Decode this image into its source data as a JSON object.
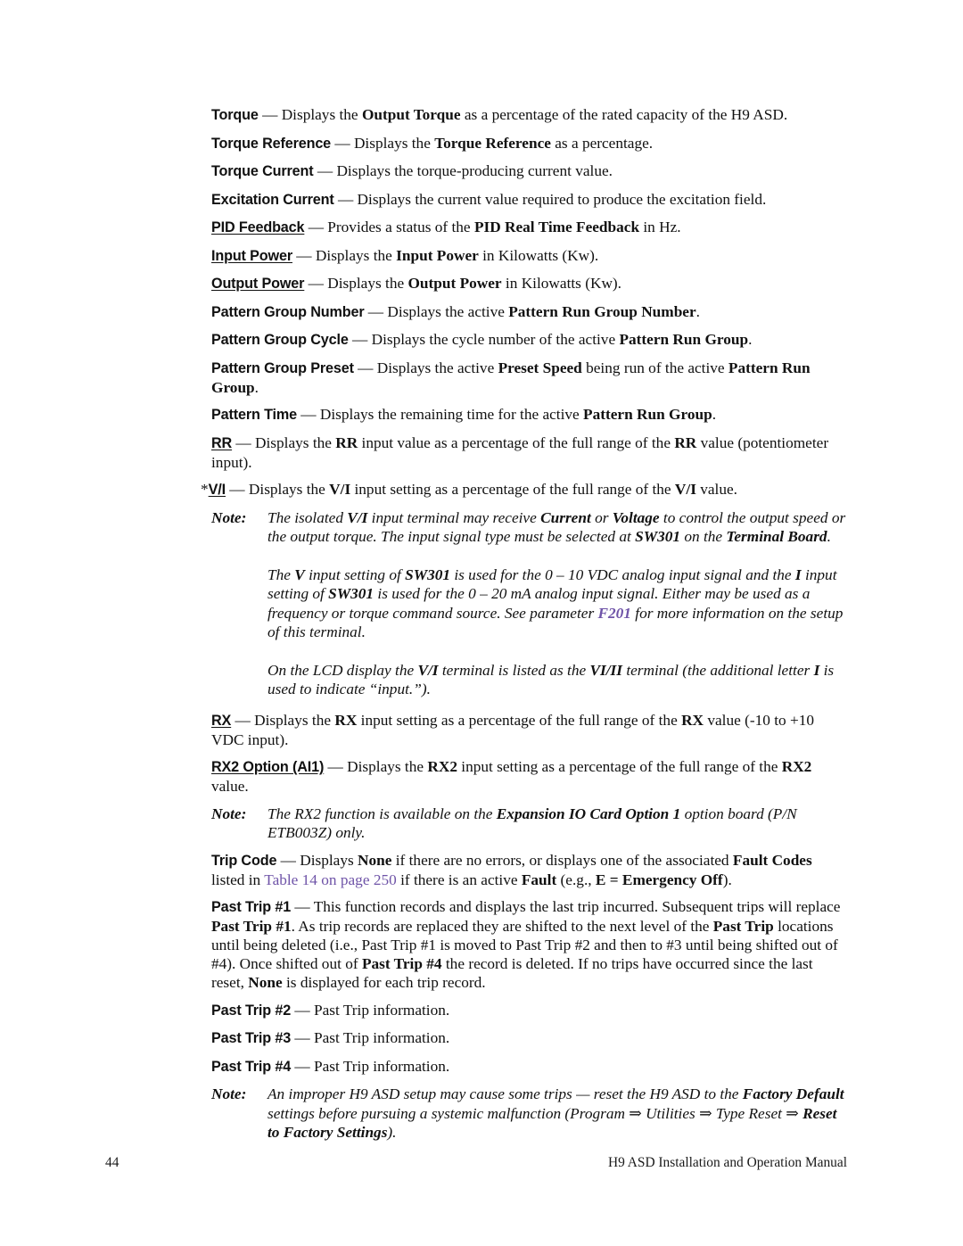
{
  "page": {
    "number": "44",
    "footer_text": "H9 ASD Installation and Operation Manual"
  },
  "colors": {
    "text": "#111111",
    "hyperlink": "#6f54a8",
    "background": "#ffffff"
  },
  "blocks": [
    {
      "id": "torque",
      "type": "entry",
      "runs": [
        {
          "t": "Torque",
          "s": "hw"
        },
        {
          "t": " — Displays the "
        },
        {
          "t": "Output Torque",
          "s": "b"
        },
        {
          "t": " as a percentage of the rated capacity of the H9 ASD."
        }
      ]
    },
    {
      "id": "torque-reference",
      "type": "entry",
      "runs": [
        {
          "t": "Torque Reference",
          "s": "hw"
        },
        {
          "t": " — Displays the "
        },
        {
          "t": "Torque Reference",
          "s": "b"
        },
        {
          "t": " as a percentage."
        }
      ]
    },
    {
      "id": "torque-current",
      "type": "entry",
      "runs": [
        {
          "t": "Torque Current",
          "s": "hw"
        },
        {
          "t": " — Displays the torque-producing current value."
        }
      ]
    },
    {
      "id": "excitation-current",
      "type": "entry",
      "runs": [
        {
          "t": "Excitation Current",
          "s": "hw"
        },
        {
          "t": " — Displays the current value required to produce the excitation field."
        }
      ]
    },
    {
      "id": "pid-feedback",
      "type": "entry",
      "runs": [
        {
          "t": "PID Feedback",
          "s": "hw hw-u"
        },
        {
          "t": " — Provides a status of the "
        },
        {
          "t": "PID Real Time Feedback",
          "s": "b"
        },
        {
          "t": " in Hz."
        }
      ]
    },
    {
      "id": "input-power",
      "type": "entry",
      "runs": [
        {
          "t": "Input Power",
          "s": "hw hw-u"
        },
        {
          "t": " — Displays the "
        },
        {
          "t": "Input Power",
          "s": "b"
        },
        {
          "t": " in Kilowatts (Kw)."
        }
      ]
    },
    {
      "id": "output-power",
      "type": "entry",
      "runs": [
        {
          "t": "Output Power",
          "s": "hw hw-u"
        },
        {
          "t": " — Displays the "
        },
        {
          "t": "Output Power",
          "s": "b"
        },
        {
          "t": " in Kilowatts (Kw)."
        }
      ]
    },
    {
      "id": "pattern-group-number",
      "type": "entry",
      "runs": [
        {
          "t": "Pattern Group Number",
          "s": "hw"
        },
        {
          "t": " — Displays the active "
        },
        {
          "t": "Pattern Run Group Number",
          "s": "b"
        },
        {
          "t": "."
        }
      ]
    },
    {
      "id": "pattern-group-cycle",
      "type": "entry",
      "runs": [
        {
          "t": "Pattern Group Cycle",
          "s": "hw"
        },
        {
          "t": " — Displays the cycle number of the active "
        },
        {
          "t": "Pattern Run Group",
          "s": "b"
        },
        {
          "t": "."
        }
      ]
    },
    {
      "id": "pattern-group-preset",
      "type": "entry",
      "runs": [
        {
          "t": "Pattern Group Preset",
          "s": "hw"
        },
        {
          "t": " — Displays the active "
        },
        {
          "t": "Preset Speed",
          "s": "b"
        },
        {
          "t": " being run of the active "
        },
        {
          "t": "Pattern Run Group",
          "s": "b"
        },
        {
          "t": "."
        }
      ]
    },
    {
      "id": "pattern-time",
      "type": "entry",
      "runs": [
        {
          "t": "Pattern Time",
          "s": "hw"
        },
        {
          "t": " — Displays the remaining time for the active "
        },
        {
          "t": "Pattern Run Group",
          "s": "b"
        },
        {
          "t": "."
        }
      ]
    },
    {
      "id": "rr",
      "type": "entry",
      "runs": [
        {
          "t": "RR",
          "s": "hw hw-u"
        },
        {
          "t": " — Displays the "
        },
        {
          "t": "RR",
          "s": "b"
        },
        {
          "t": " input value as a percentage of the full range of the "
        },
        {
          "t": "RR",
          "s": "b"
        },
        {
          "t": " value (potentiometer input)."
        }
      ]
    },
    {
      "id": "vi",
      "type": "entry-hang",
      "runs": [
        {
          "t": "*",
          "s": "star"
        },
        {
          "t": "V/I",
          "s": "hw hw-u"
        },
        {
          "t": " — Displays the "
        },
        {
          "t": "V/I",
          "s": "b"
        },
        {
          "t": " input setting as a percentage of the full range of the "
        },
        {
          "t": "V/I",
          "s": "b"
        },
        {
          "t": " value."
        }
      ]
    },
    {
      "id": "note-vi",
      "type": "note",
      "label": "Note:",
      "gap": "gap-md",
      "paras": [
        [
          {
            "t": "The isolated ",
            "s": "i"
          },
          {
            "t": "V/I",
            "s": "bi"
          },
          {
            "t": " input terminal may receive ",
            "s": "i"
          },
          {
            "t": "Current",
            "s": "bi"
          },
          {
            "t": " or ",
            "s": "i"
          },
          {
            "t": "Voltage",
            "s": "bi"
          },
          {
            "t": " to control the output speed or the output torque. The input signal type must be selected at ",
            "s": "i"
          },
          {
            "t": "SW301",
            "s": "bi"
          },
          {
            "t": " on the ",
            "s": "i"
          },
          {
            "t": "Terminal Board",
            "s": "bi"
          },
          {
            "t": ".",
            "s": "i"
          }
        ],
        [
          {
            "t": "The ",
            "s": "i"
          },
          {
            "t": "V",
            "s": "bi"
          },
          {
            "t": " input setting of ",
            "s": "i"
          },
          {
            "t": "SW301",
            "s": "bi"
          },
          {
            "t": " is used for the 0 – 10 VDC analog input signal and the ",
            "s": "i"
          },
          {
            "t": "I",
            "s": "bi"
          },
          {
            "t": " input setting of ",
            "s": "i"
          },
          {
            "t": "SW301",
            "s": "bi"
          },
          {
            "t": " is used for the 0 – 20 mA analog input signal. Either may be used as a frequency or torque command source. See parameter ",
            "s": "i"
          },
          {
            "t": "F201",
            "s": "link-b"
          },
          {
            "t": " for more information on the setup of this terminal.",
            "s": "i"
          }
        ],
        [
          {
            "t": "On the LCD display the ",
            "s": "i"
          },
          {
            "t": "V/I",
            "s": "bi"
          },
          {
            "t": " terminal is listed as the ",
            "s": "i"
          },
          {
            "t": "VI/II",
            "s": "bi"
          },
          {
            "t": " terminal (the additional letter ",
            "s": "i"
          },
          {
            "t": "I",
            "s": "bi"
          },
          {
            "t": " is used to indicate “input.”).",
            "s": "i"
          }
        ]
      ]
    },
    {
      "id": "rx",
      "type": "entry",
      "runs": [
        {
          "t": "RX",
          "s": "hw hw-u"
        },
        {
          "t": " — Displays the "
        },
        {
          "t": "RX",
          "s": "b"
        },
        {
          "t": " input setting as a percentage of the full range of the "
        },
        {
          "t": "RX",
          "s": "b"
        },
        {
          "t": " value (-10 to +10 VDC input)."
        }
      ]
    },
    {
      "id": "rx2-option",
      "type": "entry",
      "runs": [
        {
          "t": "RX2 Option (AI1)",
          "s": "hw hw-u"
        },
        {
          "t": " — Displays the "
        },
        {
          "t": "RX2",
          "s": "b"
        },
        {
          "t": " input setting as a percentage of the full range of the "
        },
        {
          "t": "RX2",
          "s": "b"
        },
        {
          "t": " value."
        }
      ]
    },
    {
      "id": "note-rx2",
      "type": "note",
      "label": "Note:",
      "gap": "gap-sm",
      "paras": [
        [
          {
            "t": "The RX2 function is available on the ",
            "s": "i"
          },
          {
            "t": "Expansion IO Card Option 1",
            "s": "bi"
          },
          {
            "t": " option board (P/N ETB003Z) only.",
            "s": "i"
          }
        ]
      ]
    },
    {
      "id": "trip-code",
      "type": "entry",
      "runs": [
        {
          "t": "Trip Code",
          "s": "hw"
        },
        {
          "t": " — Displays "
        },
        {
          "t": "None",
          "s": "b"
        },
        {
          "t": " if there are no errors, or displays one of the associated "
        },
        {
          "t": "Fault Codes",
          "s": "b"
        },
        {
          "t": " listed in "
        },
        {
          "t": "Table 14 on page 250",
          "s": "link"
        },
        {
          "t": " if there is an active "
        },
        {
          "t": "Fault",
          "s": "b"
        },
        {
          "t": " (e.g., "
        },
        {
          "t": "E = Emergency Off",
          "s": "b"
        },
        {
          "t": ")."
        }
      ]
    },
    {
      "id": "past-trip-1",
      "type": "entry",
      "runs": [
        {
          "t": "Past Trip #1",
          "s": "hw"
        },
        {
          "t": " — This function records and displays the last trip incurred. Subsequent trips will replace "
        },
        {
          "t": "Past Trip #1",
          "s": "b"
        },
        {
          "t": ". As trip records are replaced they are shifted to the next level of the "
        },
        {
          "t": "Past Trip",
          "s": "b"
        },
        {
          "t": " locations until being deleted (i.e., Past Trip #1 is moved to Past Trip #2 and then to #3 until being shifted out of #4). Once shifted out of "
        },
        {
          "t": "Past Trip #4",
          "s": "b"
        },
        {
          "t": " the record is deleted. If no trips have occurred since the last reset, "
        },
        {
          "t": "None",
          "s": "b"
        },
        {
          "t": " is displayed for each trip record."
        }
      ]
    },
    {
      "id": "past-trip-2",
      "type": "entry",
      "runs": [
        {
          "t": "Past Trip #2",
          "s": "hw"
        },
        {
          "t": " — Past Trip information."
        }
      ]
    },
    {
      "id": "past-trip-3",
      "type": "entry",
      "runs": [
        {
          "t": "Past Trip #3",
          "s": "hw"
        },
        {
          "t": " — Past Trip information."
        }
      ]
    },
    {
      "id": "past-trip-4",
      "type": "entry",
      "runs": [
        {
          "t": "Past Trip #4",
          "s": "hw"
        },
        {
          "t": " — Past Trip information."
        }
      ]
    },
    {
      "id": "note-improper-setup",
      "type": "note",
      "label": "Note:",
      "gap": "gap-sm",
      "paras": [
        [
          {
            "t": "An improper H9 ASD setup may cause some trips — reset the H9 ASD to the ",
            "s": "i"
          },
          {
            "t": "Factory Default",
            "s": "bi"
          },
          {
            "t": " settings before pursuing a systemic malfunction (Program ⇒ Utilities ⇒ Type Reset ⇒ ",
            "s": "i"
          },
          {
            "t": "Reset to Factory Settings",
            "s": "bi"
          },
          {
            "t": ").",
            "s": "i"
          }
        ]
      ]
    }
  ]
}
